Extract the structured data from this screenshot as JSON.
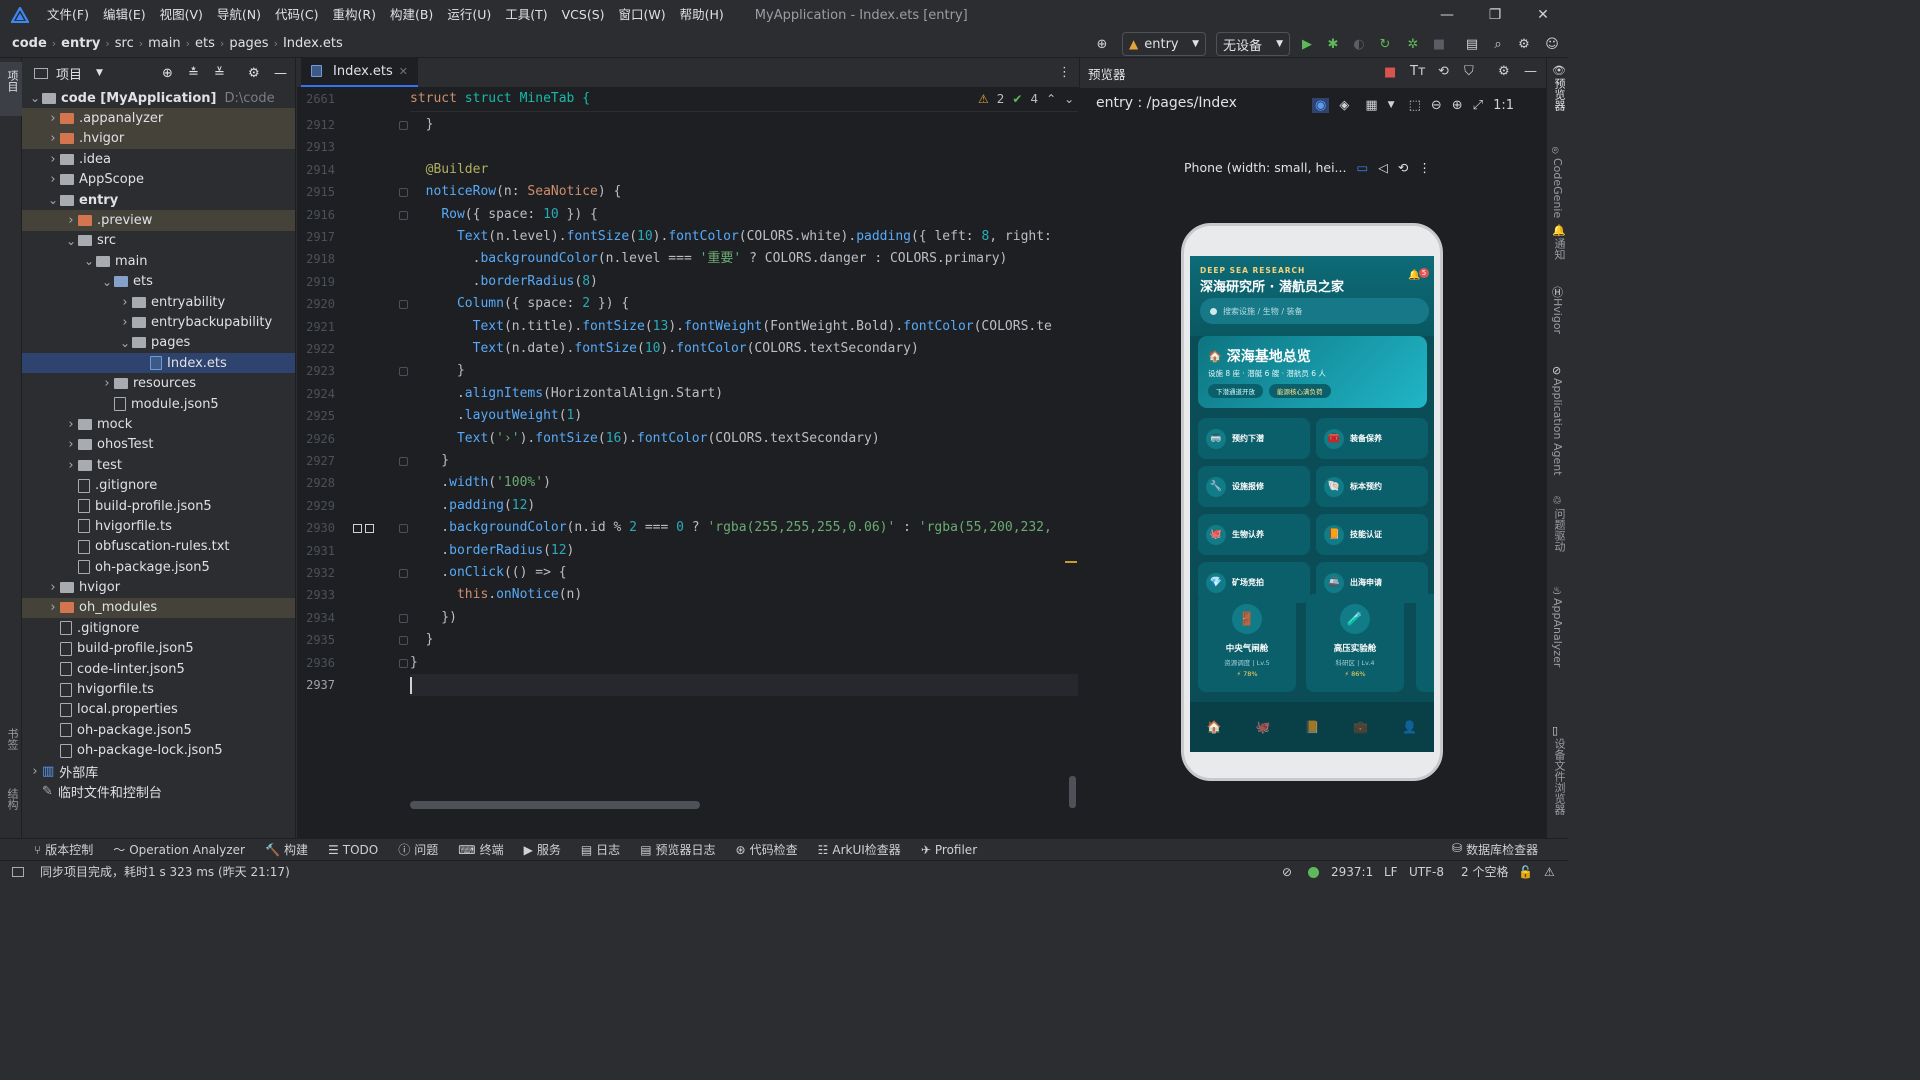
{
  "window": {
    "title": "MyApplication - Index.ets [entry]",
    "menu": [
      "文件(F)",
      "编辑(E)",
      "视图(V)",
      "导航(N)",
      "代码(C)",
      "重构(R)",
      "构建(B)",
      "运行(U)",
      "工具(T)",
      "VCS(S)",
      "窗口(W)",
      "帮助(H)"
    ]
  },
  "breadcrumb": [
    "code",
    "entry",
    "src",
    "main",
    "ets",
    "pages",
    "Index.ets"
  ],
  "toolbar": {
    "run_config": "entry",
    "device": "无设备"
  },
  "project": {
    "title": "项目",
    "tree": [
      {
        "label": "code [MyApplication]",
        "extra": "D:\\code",
        "depth": 0,
        "open": true,
        "kind": "module",
        "bold": true
      },
      {
        "label": ".appanalyzer",
        "depth": 1,
        "open": false,
        "kind": "folder-orange",
        "hl": true
      },
      {
        "label": ".hvigor",
        "depth": 1,
        "open": false,
        "kind": "folder-orange",
        "hl": true
      },
      {
        "label": ".idea",
        "depth": 1,
        "open": false,
        "kind": "folder"
      },
      {
        "label": "AppScope",
        "depth": 1,
        "open": false,
        "kind": "folder"
      },
      {
        "label": "entry",
        "depth": 1,
        "open": true,
        "kind": "module",
        "bold": true
      },
      {
        "label": ".preview",
        "depth": 2,
        "open": false,
        "kind": "folder-orange",
        "hl": true
      },
      {
        "label": "src",
        "depth": 2,
        "open": true,
        "kind": "folder"
      },
      {
        "label": "main",
        "depth": 3,
        "open": true,
        "kind": "folder"
      },
      {
        "label": "ets",
        "depth": 4,
        "open": true,
        "kind": "folder-blue"
      },
      {
        "label": "entryability",
        "depth": 5,
        "open": false,
        "kind": "folder"
      },
      {
        "label": "entrybackupability",
        "depth": 5,
        "open": false,
        "kind": "folder"
      },
      {
        "label": "pages",
        "depth": 5,
        "open": true,
        "kind": "folder"
      },
      {
        "label": "Index.ets",
        "depth": 6,
        "kind": "ets",
        "sel": true
      },
      {
        "label": "resources",
        "depth": 4,
        "open": false,
        "kind": "folder"
      },
      {
        "label": "module.json5",
        "depth": 4,
        "kind": "file"
      },
      {
        "label": "mock",
        "depth": 2,
        "open": false,
        "kind": "folder"
      },
      {
        "label": "ohosTest",
        "depth": 2,
        "open": false,
        "kind": "folder"
      },
      {
        "label": "test",
        "depth": 2,
        "open": false,
        "kind": "folder"
      },
      {
        "label": ".gitignore",
        "depth": 2,
        "kind": "file"
      },
      {
        "label": "build-profile.json5",
        "depth": 2,
        "kind": "file"
      },
      {
        "label": "hvigorfile.ts",
        "depth": 2,
        "kind": "file"
      },
      {
        "label": "obfuscation-rules.txt",
        "depth": 2,
        "kind": "file"
      },
      {
        "label": "oh-package.json5",
        "depth": 2,
        "kind": "file"
      },
      {
        "label": "hvigor",
        "depth": 1,
        "open": false,
        "kind": "folder"
      },
      {
        "label": "oh_modules",
        "depth": 1,
        "open": false,
        "kind": "folder-orange",
        "hl": true
      },
      {
        "label": ".gitignore",
        "depth": 1,
        "kind": "file"
      },
      {
        "label": "build-profile.json5",
        "depth": 1,
        "kind": "file"
      },
      {
        "label": "code-linter.json5",
        "depth": 1,
        "kind": "file"
      },
      {
        "label": "hvigorfile.ts",
        "depth": 1,
        "kind": "file"
      },
      {
        "label": "local.properties",
        "depth": 1,
        "kind": "file"
      },
      {
        "label": "oh-package.json5",
        "depth": 1,
        "kind": "file"
      },
      {
        "label": "oh-package-lock.json5",
        "depth": 1,
        "kind": "file"
      },
      {
        "label": "外部库",
        "depth": 0,
        "open": false,
        "kind": "lib"
      },
      {
        "label": "临时文件和控制台",
        "depth": 0,
        "kind": "scratch"
      }
    ]
  },
  "editor": {
    "tab": "Index.ets",
    "sticky_line": {
      "num": "2661",
      "text": "struct MineTab {"
    },
    "inspections": {
      "warnings": "2",
      "ok": "4"
    },
    "lines": [
      {
        "num": "2912",
        "html": "  }"
      },
      {
        "num": "2913",
        "html": ""
      },
      {
        "num": "2914",
        "html": "  <span class='ann'>@Builder</span>"
      },
      {
        "num": "2915",
        "html": "  <span class='fn'>noticeRow</span>(n: <span class='kw'>SeaNotice</span>) {"
      },
      {
        "num": "2916",
        "html": "    <span class='fn'>Row</span>({ space: <span class='num'>10</span> }) {"
      },
      {
        "num": "2917",
        "html": "      <span class='fn'>Text</span>(n.level).<span class='fn'>fontSize</span>(<span class='num'>10</span>).<span class='fn'>fontColor</span>(COLORS.white).<span class='fn'>padding</span>({ left: <span class='num'>8</span>, right:"
      },
      {
        "num": "2918",
        "html": "        .<span class='fn'>backgroundColor</span>(n.level === <span class='str'>'重要'</span> ? COLORS.danger : COLORS.primary)"
      },
      {
        "num": "2919",
        "html": "        .<span class='fn'>borderRadius</span>(<span class='num'>8</span>)"
      },
      {
        "num": "2920",
        "html": "      <span class='fn'>Column</span>({ space: <span class='num'>2</span> }) {"
      },
      {
        "num": "2921",
        "html": "        <span class='fn'>Text</span>(n.title).<span class='fn'>fontSize</span>(<span class='num'>13</span>).<span class='fn'>fontWeight</span>(FontWeight.Bold).<span class='fn'>fontColor</span>(COLORS.te"
      },
      {
        "num": "2922",
        "html": "        <span class='fn'>Text</span>(n.date).<span class='fn'>fontSize</span>(<span class='num'>10</span>).<span class='fn'>fontColor</span>(COLORS.textSecondary)"
      },
      {
        "num": "2923",
        "html": "      }"
      },
      {
        "num": "2924",
        "html": "      .<span class='fn'>alignItems</span>(HorizontalAlign.Start)"
      },
      {
        "num": "2925",
        "html": "      .<span class='fn'>layoutWeight</span>(<span class='num'>1</span>)"
      },
      {
        "num": "2926",
        "html": "      <span class='fn'>Text</span>(<span class='str'>'›'</span>).<span class='fn'>fontSize</span>(<span class='num'>16</span>).<span class='fn'>fontColor</span>(COLORS.textSecondary)"
      },
      {
        "num": "2927",
        "html": "    }"
      },
      {
        "num": "2928",
        "html": "    .<span class='fn'>width</span>(<span class='str'>'100%'</span>)"
      },
      {
        "num": "2929",
        "html": "    .<span class='fn'>padding</span>(<span class='num'>12</span>)"
      },
      {
        "num": "2930",
        "html": "    .<span class='fn'>backgroundColor</span>(n.id % <span class='num'>2</span> === <span class='num'>0</span> ? <span class='str'>'rgba(255,255,255,0.06)'</span> : <span class='str'>'rgba(55,200,232,</span>"
      },
      {
        "num": "2931",
        "html": "    .<span class='fn'>borderRadius</span>(<span class='num'>12</span>)"
      },
      {
        "num": "2932",
        "html": "    .<span class='fn'>onClick</span>(() => {"
      },
      {
        "num": "2933",
        "html": "      <span class='kw'>this</span>.<span class='fn'>onNotice</span>(n)"
      },
      {
        "num": "2934",
        "html": "    })"
      },
      {
        "num": "2935",
        "html": "  }"
      },
      {
        "num": "2936",
        "html": "}"
      },
      {
        "num": "2937",
        "html": ""
      }
    ]
  },
  "preview": {
    "panel_title": "预览器",
    "route": "entry : /pages/Index",
    "device_label": "Phone (width: small, hei...",
    "app": {
      "header_en": "DEEP SEA RESEARCH",
      "header_cn": "深海研究所 · 潜航员之家",
      "badge": "5",
      "search_placeholder": "搜索设施 / 生物 / 装备",
      "hero_title": "深海基地总览",
      "hero_sub": "设施 8 座 · 潜艇 6 艘 · 潜航员 6 人",
      "hero_chip1": "下潜通道开放",
      "hero_chip2": "能源核心满负荷",
      "grid": [
        "预约下潜",
        "装备保养",
        "设施报修",
        "标本预约",
        "生物认养",
        "技能认证",
        "矿场竞拍",
        "出海申请"
      ],
      "cards": [
        {
          "title": "中央气闸舱",
          "sub": "资源调度 | Lv.5",
          "pct": "⚡ 78%"
        },
        {
          "title": "高压实验舱",
          "sub": "科研区 | Lv.4",
          "pct": "⚡ 86%"
        }
      ]
    }
  },
  "bottom_tools": [
    "版本控制",
    "Operation Analyzer",
    "构建",
    "TODO",
    "问题",
    "终端",
    "服务",
    "日志",
    "预览器日志",
    "代码检查",
    "ArkUI检查器",
    "Profiler"
  ],
  "db_inspector": "数据库检查器",
  "status": {
    "message": "同步项目完成，耗时1 s 323 ms (昨天 21:17)",
    "position": "2937:1",
    "line_sep": "LF",
    "encoding": "UTF-8",
    "indent": "2 个空格"
  },
  "strips": {
    "left_top": "项目",
    "left_bottom1": "书签",
    "left_bottom2": "结构",
    "right": [
      "预览器",
      "CodeGenie",
      "通知",
      "Hvigor",
      "Application Agent",
      "问题驱动",
      "AppAnalyzer",
      "设备文件浏览器"
    ]
  }
}
